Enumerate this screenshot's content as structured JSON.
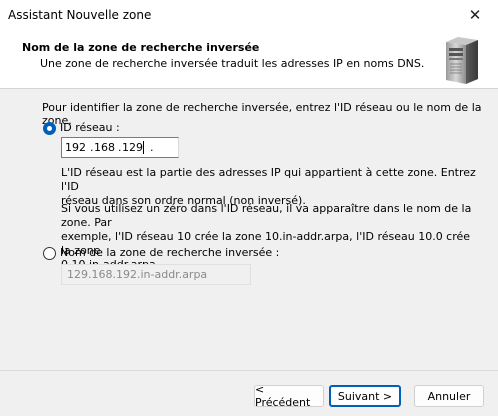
{
  "window": {
    "title": "Assistant Nouvelle zone"
  },
  "header": {
    "title": "Nom de la zone de recherche inversée",
    "subtitle": "Une zone de recherche inversée traduit les adresses IP en noms DNS."
  },
  "intro": "Pour identifier la zone de recherche inversée, entrez l'ID réseau ou le nom de la zone.",
  "option_network_id": {
    "label": "ID réseau :",
    "selected": true,
    "octets": [
      "192",
      "168",
      "129",
      ""
    ]
  },
  "help_line1": "L'ID réseau est la partie des adresses IP qui appartient à cette zone. Entrez l'ID",
  "help_line2": "réseau dans son ordre normal (non inversé).",
  "zero_line1": "Si vous utilisez un zéro dans l'ID réseau, il va apparaître dans le nom de la zone. Par",
  "zero_line2": "exemple, l'ID réseau 10 crée la zone 10.in-addr.arpa, l'ID réseau 10.0 crée la zone",
  "zero_line3": "0.10.in-addr.arpa.",
  "option_zone_name": {
    "label": "Nom de la zone de recherche inversée :",
    "selected": false,
    "value": "129.168.192.in-addr.arpa"
  },
  "buttons": {
    "back": "< Précédent",
    "next": "Suivant >",
    "cancel": "Annuler"
  }
}
